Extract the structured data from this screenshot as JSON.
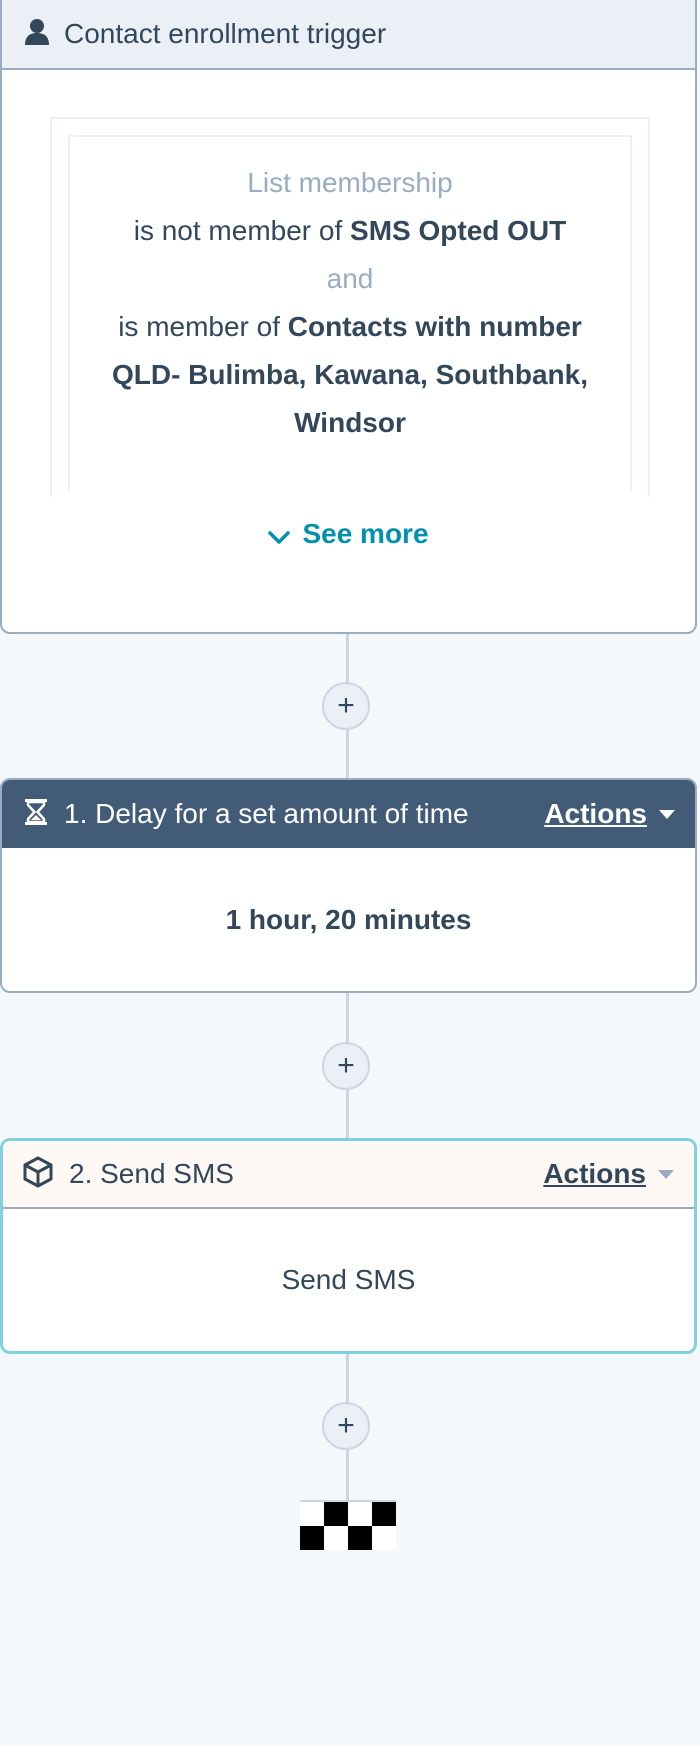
{
  "trigger": {
    "title": "Contact enrollment trigger",
    "icon": "contact-icon",
    "filter": {
      "heading": "List membership",
      "condition1_prefix": "is not member of ",
      "condition1_value": "SMS Opted OUT",
      "joiner": "and",
      "condition2_prefix": "is member of ",
      "condition2_value_line1": "Contacts with number",
      "condition2_value_line2": "QLD- Bulimba, Kawana, Southbank,",
      "condition2_value_line3": "Windsor"
    },
    "see_more_label": "See more"
  },
  "add_step_symbol": "+",
  "steps": [
    {
      "title": "1. Delay for a set amount of time",
      "icon": "hourglass-icon",
      "actions_label": "Actions",
      "body": "1 hour, 20 minutes"
    },
    {
      "title": "2. Send SMS",
      "icon": "cube-icon",
      "actions_label": "Actions",
      "body": "Send SMS"
    }
  ],
  "end_icon": "checkered-flag-icon",
  "colors": {
    "background": "#f5f8fa",
    "accent_link": "#0091ae",
    "delay_header": "#425b76",
    "sms_border": "#7fd1de"
  }
}
